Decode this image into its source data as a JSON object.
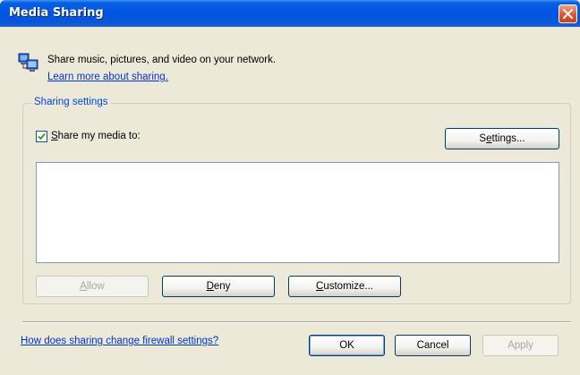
{
  "window": {
    "title": "Media Sharing"
  },
  "header": {
    "description": "Share music, pictures, and video on your network.",
    "learn_more_link": "Learn more about sharing."
  },
  "sharing_settings": {
    "group_label": "Sharing settings",
    "share_checkbox": {
      "label_prefix": "S",
      "label_rest": "hare my media to:",
      "checked": true
    },
    "settings_button": {
      "prefix": "S",
      "mnemonic": "e",
      "suffix": "ttings..."
    },
    "devices_list": [],
    "allow_button": {
      "mnemonic": "A",
      "suffix": "llow",
      "enabled": false
    },
    "deny_button": {
      "mnemonic": "D",
      "suffix": "eny"
    },
    "customize_button": {
      "mnemonic": "C",
      "suffix": "ustomize..."
    }
  },
  "footer": {
    "firewall_link": "How does sharing change firewall settings?",
    "ok_label": "OK",
    "cancel_label": "Cancel",
    "apply_label": "Apply"
  },
  "colors": {
    "titlebar": "#0054e3",
    "dialog_bg": "#ece9d8",
    "link": "#0033cc",
    "group_label": "#0046d5"
  },
  "icons": {
    "header": "network-computers-icon",
    "close": "close-icon",
    "check": "checkmark-icon"
  }
}
